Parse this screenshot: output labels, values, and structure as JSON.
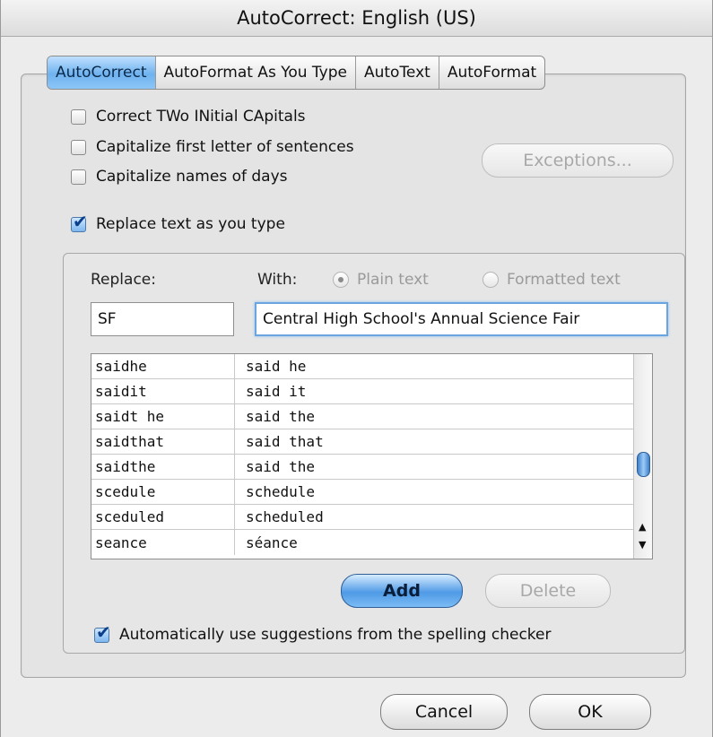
{
  "window": {
    "title": "AutoCorrect: English (US)"
  },
  "tabs": [
    {
      "label": "AutoCorrect",
      "selected": true
    },
    {
      "label": "AutoFormat As You Type",
      "selected": false
    },
    {
      "label": "AutoText",
      "selected": false
    },
    {
      "label": "AutoFormat",
      "selected": false
    }
  ],
  "options": {
    "correct_two_initial": {
      "label": "Correct TWo INitial CApitals",
      "checked": false
    },
    "capitalize_first": {
      "label": "Capitalize first letter of sentences",
      "checked": false
    },
    "capitalize_days": {
      "label": "Capitalize names of days",
      "checked": false
    },
    "replace_as_you_type": {
      "label": "Replace text as you type",
      "checked": true
    },
    "auto_suggestions": {
      "label": "Automatically use suggestions from the spelling checker",
      "checked": true
    }
  },
  "buttons": {
    "exceptions": "Exceptions...",
    "add": "Add",
    "delete": "Delete",
    "cancel": "Cancel",
    "ok": "OK"
  },
  "replace_section": {
    "replace_label": "Replace:",
    "with_label": "With:",
    "plain_text_label": "Plain text",
    "formatted_text_label": "Formatted text",
    "selected_mode": "Plain text",
    "replace_value": "SF",
    "with_value": "Central High School's Annual Science Fair"
  },
  "entries": [
    {
      "replace": "saidhe",
      "with": "said he"
    },
    {
      "replace": "saidit",
      "with": "said it"
    },
    {
      "replace": "saidt he",
      "with": "said the"
    },
    {
      "replace": "saidthat",
      "with": "said that"
    },
    {
      "replace": "saidthe",
      "with": "said the"
    },
    {
      "replace": "scedule",
      "with": "schedule"
    },
    {
      "replace": "sceduled",
      "with": "scheduled"
    },
    {
      "replace": "seance",
      "with": "séance"
    }
  ],
  "icons": {
    "check": "✔",
    "scroll_up": "▲",
    "scroll_down": "▼"
  },
  "colors": {
    "accent": "#6fb2ef",
    "default_button": "#4f9ae6"
  }
}
